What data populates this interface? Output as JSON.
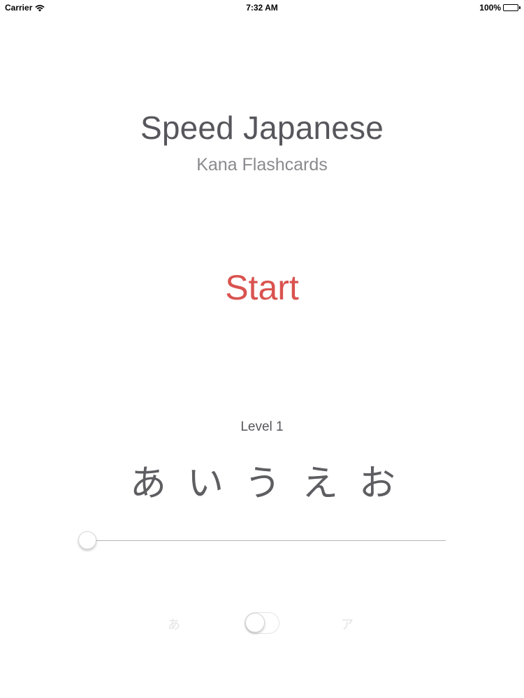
{
  "status_bar": {
    "carrier": "Carrier",
    "time": "7:32 AM",
    "battery": "100%"
  },
  "header": {
    "title": "Speed Japanese",
    "subtitle": "Kana Flashcards"
  },
  "main": {
    "start_label": "Start",
    "start_color": "#d9534f"
  },
  "level": {
    "label": "Level 1",
    "kana": [
      "あ",
      "い",
      "う",
      "え",
      "お"
    ],
    "slider_fraction": 0
  },
  "mode": {
    "hiragana_label": "あ",
    "katakana_label": "ア",
    "toggle_on": false
  }
}
